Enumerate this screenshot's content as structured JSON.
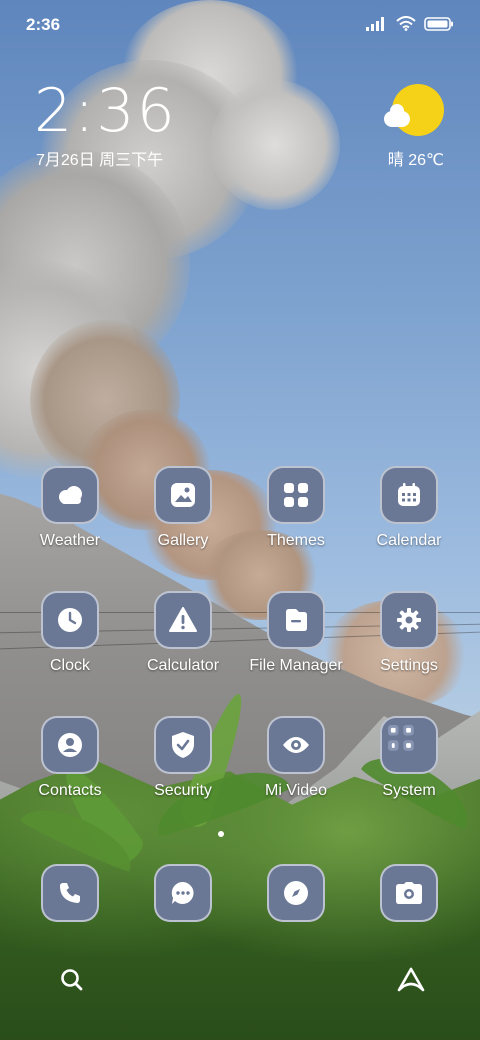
{
  "status_bar": {
    "time": "2:36",
    "icons": [
      "signal-icon",
      "wifi-icon",
      "battery-icon"
    ]
  },
  "clock_widget": {
    "time": "2:36",
    "date": "7月26日 周三下午"
  },
  "weather_widget": {
    "text": "晴 26℃",
    "icon": "sun-cloud-icon"
  },
  "apps": [
    {
      "label": "Weather",
      "icon": "cloud-icon"
    },
    {
      "label": "Gallery",
      "icon": "image-icon"
    },
    {
      "label": "Themes",
      "icon": "grid-icon"
    },
    {
      "label": "Calendar",
      "icon": "calendar-icon"
    },
    {
      "label": "Clock",
      "icon": "clock-icon"
    },
    {
      "label": "Calculator",
      "icon": "warning-icon"
    },
    {
      "label": "File Manager",
      "icon": "folder-icon"
    },
    {
      "label": "Settings",
      "icon": "gear-icon"
    },
    {
      "label": "Contacts",
      "icon": "person-icon"
    },
    {
      "label": "Security",
      "icon": "shield-check-icon"
    },
    {
      "label": "Mi Video",
      "icon": "eye-icon"
    },
    {
      "label": "System",
      "icon": "folder-grid-icon"
    }
  ],
  "dock": [
    {
      "icon": "phone-icon"
    },
    {
      "icon": "message-icon"
    },
    {
      "icon": "compass-icon"
    },
    {
      "icon": "camera-icon"
    }
  ],
  "bottom_bar": {
    "left_icon": "search-icon",
    "right_icon": "assistant-icon"
  },
  "colors": {
    "icon_bg": "#6a7896",
    "sun": "#f5d118"
  }
}
